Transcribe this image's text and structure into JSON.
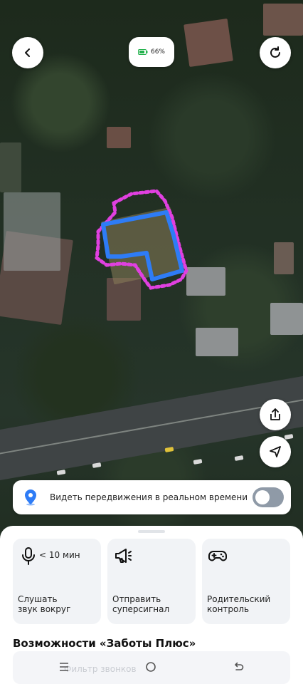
{
  "map": {
    "description_none": ""
  },
  "top": {
    "battery": "66%"
  },
  "realtime": {
    "label": "Видеть передвижения в реальном времени",
    "enabled": false
  },
  "features": [
    {
      "sub": "< 10 мин",
      "title_line1": "Слушать",
      "title_line2": "звук вокруг"
    },
    {
      "sub": "",
      "title_line1": "Отправить",
      "title_line2": "суперсигнал"
    },
    {
      "sub": "",
      "title_line1": "Родительский",
      "title_line2": "контроль"
    }
  ],
  "section": {
    "title": "Возможности «Заботы Плюс»"
  },
  "ghost": {
    "text": "Фильтр звонков"
  },
  "colors": {
    "accent": "#2e7cf6",
    "zone": "#e040e0",
    "card": "#f1f3f6"
  },
  "icons": {
    "back": "chevron-left-icon",
    "refresh": "refresh-icon",
    "share": "share-icon",
    "locate": "navigation-arrow-icon",
    "location": "location-pin-icon",
    "mic": "microphone-icon",
    "megaphone": "megaphone-icon",
    "gamepad": "gamepad-icon"
  }
}
